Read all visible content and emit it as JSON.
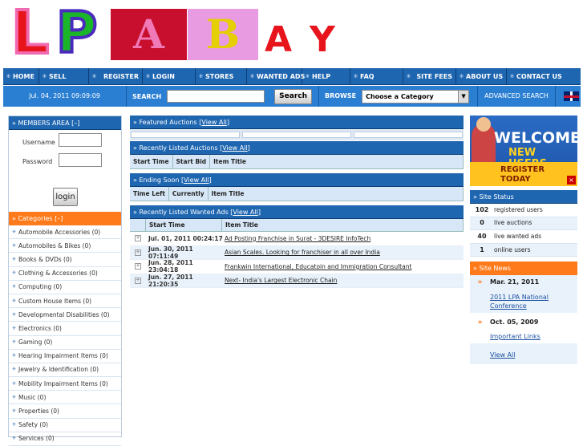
{
  "logo": {
    "letters": [
      "L",
      "P",
      "A",
      "B",
      "A",
      "Y"
    ]
  },
  "nav": [
    "HOME",
    "SELL",
    "REGISTER",
    "LOGIN",
    "STORES",
    "WANTED ADS",
    "HELP",
    "FAQ",
    "SITE FEES",
    "ABOUT US",
    "CONTACT US"
  ],
  "topbar": {
    "date": "Jul. 04, 2011 09:09:09",
    "search_label": "SEARCH",
    "search_button": "Search",
    "browse_label": "BROWSE",
    "category_select": "Choose a Category",
    "advanced": "ADVANCED SEARCH"
  },
  "members": {
    "title": "» MEMBERS AREA [–]",
    "username": "Username",
    "password": "Password",
    "login": "login"
  },
  "categories": {
    "title": "» Categories [–]",
    "items": [
      "Automobile Accessories (0)",
      "Automobiles & Bikes (0)",
      "Books & DVDs (0)",
      "Clothing & Accessories (0)",
      "Computing (0)",
      "Custom House Items (0)",
      "Developmental Disabilities (0)",
      "Electronics (0)",
      "Gaming (0)",
      "Hearing Impairment Items (0)",
      "Jewelry & Identification (0)",
      "Mobility Impairment Items (0)",
      "Music (0)",
      "Properties (0)",
      "Safety (0)",
      "Services (0)"
    ]
  },
  "featured": {
    "title": "» Featured Auctions [",
    "link": "View All",
    "end": "]"
  },
  "recent": {
    "title": "» Recently Listed Auctions [",
    "link": "View All",
    "end": "]",
    "cols": [
      "Start Time",
      "Start Bid",
      "Item Title"
    ]
  },
  "ending": {
    "title": "» Ending Soon [",
    "link": "View All",
    "end": "]",
    "cols": [
      "Time Left",
      "Currently",
      "Item Title"
    ]
  },
  "wanted": {
    "title": "» Recently Listed Wanted Ads [",
    "link": "View All",
    "end": "]",
    "cols": [
      "Start Time",
      "Item Title"
    ],
    "rows": [
      {
        "date": "Jul. 01, 2011 00:24:17",
        "title": "Ad Posting Franchise in Surat - 3DESIRE InfoTech"
      },
      {
        "date": "Jun. 30, 2011 07:11:49",
        "title": "Asian Scales. Looking for franchiser in all over India"
      },
      {
        "date": "Jun. 28, 2011 23:04:18",
        "title": "Frankwin International, Educatoin and Immigration Consultant"
      },
      {
        "date": "Jun. 27, 2011 21:20:35",
        "title": "Next- India's Largest Electronic Chain"
      }
    ]
  },
  "banner": {
    "line1": "WELCOME",
    "line2": "NEW USERS",
    "line3": "REGISTER TODAY"
  },
  "status": {
    "title": "» Site Status",
    "items": [
      {
        "n": "102",
        "l": "registered users"
      },
      {
        "n": "0",
        "l": "live auctions"
      },
      {
        "n": "40",
        "l": "live wanted ads"
      },
      {
        "n": "1",
        "l": "online users"
      }
    ]
  },
  "news": {
    "title": "» Site News",
    "items": [
      {
        "date": "Mar. 21, 2011",
        "link": "2011 LPA National Conference"
      },
      {
        "date": "Oct. 05, 2009",
        "link": "Important Links"
      }
    ],
    "view_all": "View All"
  }
}
